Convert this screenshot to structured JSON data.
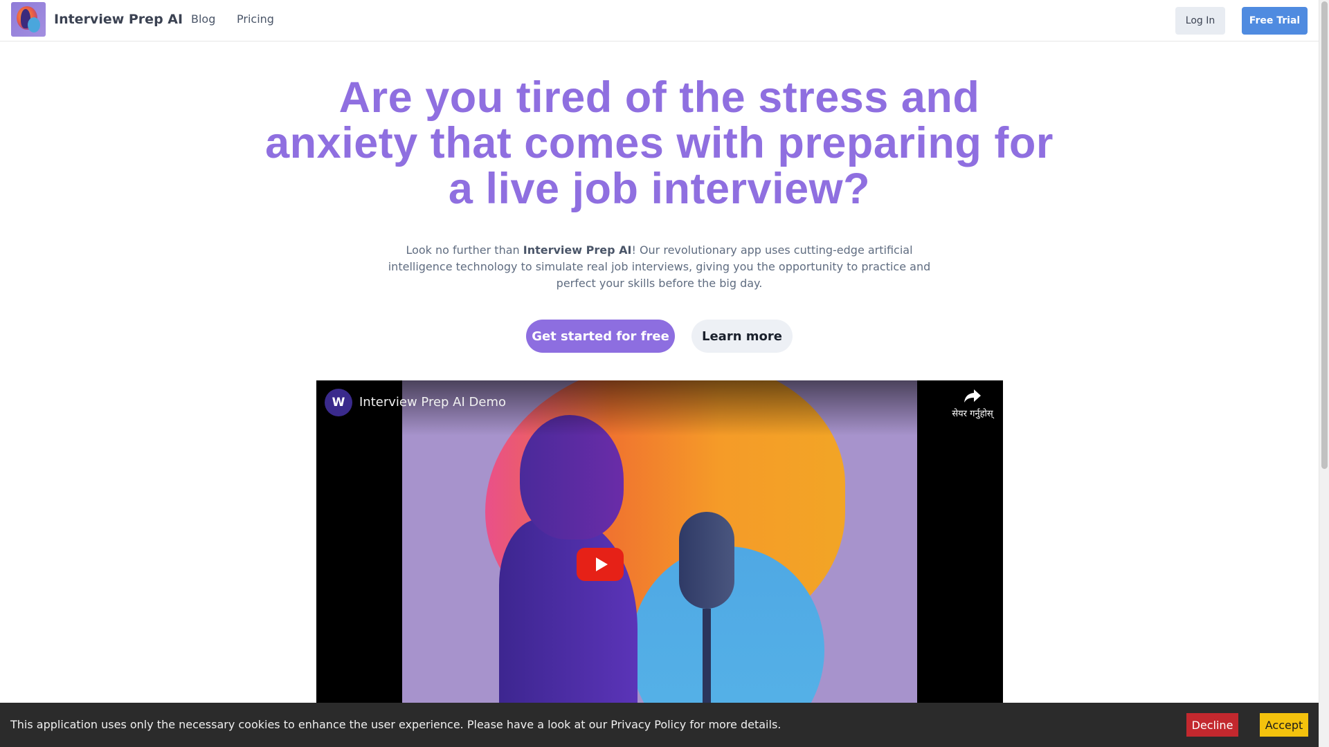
{
  "nav": {
    "brand": "Interview Prep AI",
    "links": [
      "Blog",
      "Pricing"
    ],
    "login": "Log In",
    "trial": "Free Trial"
  },
  "hero": {
    "title": "Are you tired of the stress and anxiety that comes with preparing for a live job interview?",
    "desc_before": "Look no further than ",
    "desc_bold": "Interview Prep AI",
    "desc_after": "! Our revolutionary app uses cutting-edge artificial intelligence technology to simulate real job interviews, giving you the opportunity to practice and perfect your skills before the big day.",
    "cta_primary": "Get started for free",
    "cta_secondary": "Learn more"
  },
  "video": {
    "channel_initial": "W",
    "title": "Interview Prep AI Demo",
    "share_label": "सेयर गर्नुहोस्",
    "icons": [
      "play-icon",
      "share-icon"
    ]
  },
  "cookie": {
    "text": "This application uses only the necessary cookies to enhance the user experience. Please have a look at our Privacy Policy for more details.",
    "decline": "Decline",
    "accept": "Accept"
  },
  "colors": {
    "hero_title": "#8f6fe0",
    "primary_button": "#8d6ee0",
    "trial_button": "#4f8be0",
    "decline": "#c3282e",
    "accept": "#f4c20d"
  }
}
